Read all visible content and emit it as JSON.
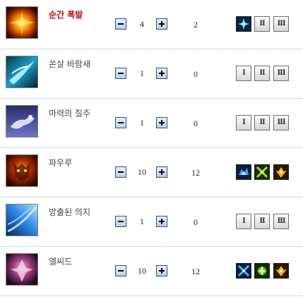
{
  "skills": [
    {
      "name": "순간 폭발",
      "level": "4",
      "points": "2",
      "icon": "fire-burst-icon",
      "slots": [
        {
          "type": "icon",
          "icon": "blue-spark-icon"
        },
        {
          "type": "roman",
          "label": "II"
        },
        {
          "type": "roman",
          "label": "III"
        }
      ]
    },
    {
      "name": "쏜살 바람새",
      "level": "1",
      "points": "0",
      "icon": "wind-bird-icon",
      "slots": [
        {
          "type": "roman",
          "label": "I"
        },
        {
          "type": "roman",
          "label": "II"
        },
        {
          "type": "roman",
          "label": "III"
        }
      ]
    },
    {
      "name": "마력의 질주",
      "level": "1",
      "points": "0",
      "icon": "spirit-horse-icon",
      "slots": [
        {
          "type": "roman",
          "label": "I"
        },
        {
          "type": "roman",
          "label": "II"
        },
        {
          "type": "roman",
          "label": "III"
        }
      ]
    },
    {
      "name": "파우루",
      "level": "10",
      "points": "12",
      "icon": "fire-beast-icon",
      "slots": [
        {
          "type": "icon",
          "icon": "blue-beast-icon"
        },
        {
          "type": "icon",
          "icon": "green-cross-icon"
        },
        {
          "type": "icon",
          "icon": "gold-bird-icon"
        }
      ]
    },
    {
      "name": "방출된 의지",
      "level": "1",
      "points": "0",
      "icon": "blue-wave-icon",
      "slots": [
        {
          "type": "roman",
          "label": "I"
        },
        {
          "type": "roman",
          "label": "II"
        },
        {
          "type": "roman",
          "label": "III"
        }
      ]
    },
    {
      "name": "엘씨드",
      "level": "10",
      "points": "12",
      "icon": "pink-spirit-icon",
      "slots": [
        {
          "type": "icon",
          "icon": "blue-cross-icon"
        },
        {
          "type": "icon",
          "icon": "green-spark-icon"
        },
        {
          "type": "icon",
          "icon": "gold-bird-icon"
        }
      ]
    }
  ]
}
